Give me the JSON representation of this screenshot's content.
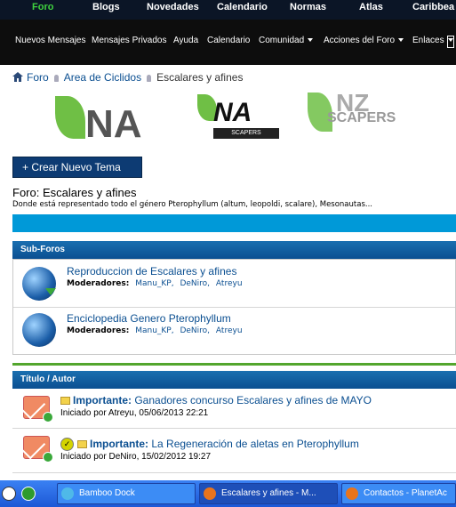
{
  "top_nav": [
    "Foro",
    "Blogs",
    "Novedades",
    "Calendario",
    "Normas",
    "Atlas",
    "Caribbea"
  ],
  "sub_nav": {
    "items": [
      "Nuevos Mensajes",
      "Mensajes Privados",
      "Ayuda",
      "Calendario"
    ],
    "dropdowns": [
      "Comunidad",
      "Acciones del Foro",
      "Enlaces"
    ]
  },
  "breadcrumb": {
    "home_link": "Foro",
    "section_link": "Area de Ciclidos",
    "current": "Escalares y afines"
  },
  "banner": {
    "logo_text": "NA",
    "logo_sub": "SCAPERS",
    "left_text": "NA",
    "right_text": "NZ",
    "right_sub": "SCAPERS"
  },
  "new_thread_button": "+ Crear Nuevo Tema",
  "forum": {
    "title": "Foro: Escalares y afines",
    "description": "Donde está representado todo el género Pterophyllum (altum, leopoldi, scalare), Mesonautas..."
  },
  "subforums": {
    "header": "Sub-Foros",
    "moderators_label": "Moderadores:",
    "items": [
      {
        "title": "Reproduccion de Escalares y afines",
        "moderators": [
          "Manu_KP,",
          "DeNiro,",
          "Atreyu"
        ]
      },
      {
        "title": "Enciclopedia Genero Pterophyllum",
        "moderators": [
          "Manu_KP,",
          "DeNiro,",
          "Atreyu"
        ]
      }
    ]
  },
  "threads": {
    "header": "Título / Autor",
    "items": [
      {
        "prefix": "Importante:",
        "title": "Ganadores concurso Escalares y afines de MAYO",
        "meta": "Iniciado por Atreyu, 05/06/2013 22:21"
      },
      {
        "prefix": "Importante:",
        "title": "La Regeneración de aletas en Pterophyllum",
        "meta": "Iniciado por DeNiro, 15/02/2012 19:27"
      }
    ]
  },
  "taskbar": {
    "buttons": [
      "Bamboo Dock",
      "Escalares y afines - M...",
      "Contactos - PlanetAc"
    ]
  },
  "colors": {
    "nav_bg": "#0b1526",
    "active_nav": "#3fd13f",
    "link": "#0b4f91",
    "bar_blue": "#0099d8",
    "green_line": "#53a62d"
  }
}
